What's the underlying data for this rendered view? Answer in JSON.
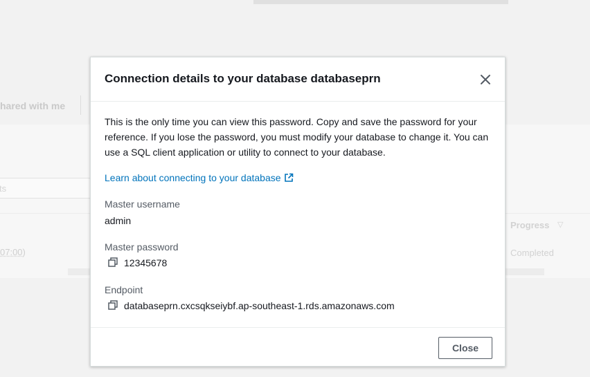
{
  "background": {
    "tab_label": "hared with me",
    "search_placeholder": "ts",
    "row_time": "07:00)",
    "progress_header": "Progress",
    "progress_value": "Completed"
  },
  "modal": {
    "title": "Connection details to your database databaseprn",
    "intro": "This is the only time you can view this password. Copy and save the password for your reference. If you lose the password, you must modify your database to change it. You can use a SQL client application or utility to connect to your database.",
    "learn_link": "Learn about connecting to your database",
    "username_label": "Master username",
    "username_value": "admin",
    "password_label": "Master password",
    "password_value": "12345678",
    "endpoint_label": "Endpoint",
    "endpoint_value": "databaseprn.cxcsqkseiybf.ap-southeast-1.rds.amazonaws.com",
    "close_button": "Close"
  },
  "icons": {
    "close": "close-icon",
    "external_link": "external-link-icon",
    "copy": "copy-icon",
    "sort": "sort-down-icon"
  },
  "colors": {
    "link": "#0073bb",
    "text": "#16191f",
    "label": "#545b64",
    "border": "#d5dbdb",
    "backdrop": "#f2f2f2"
  }
}
